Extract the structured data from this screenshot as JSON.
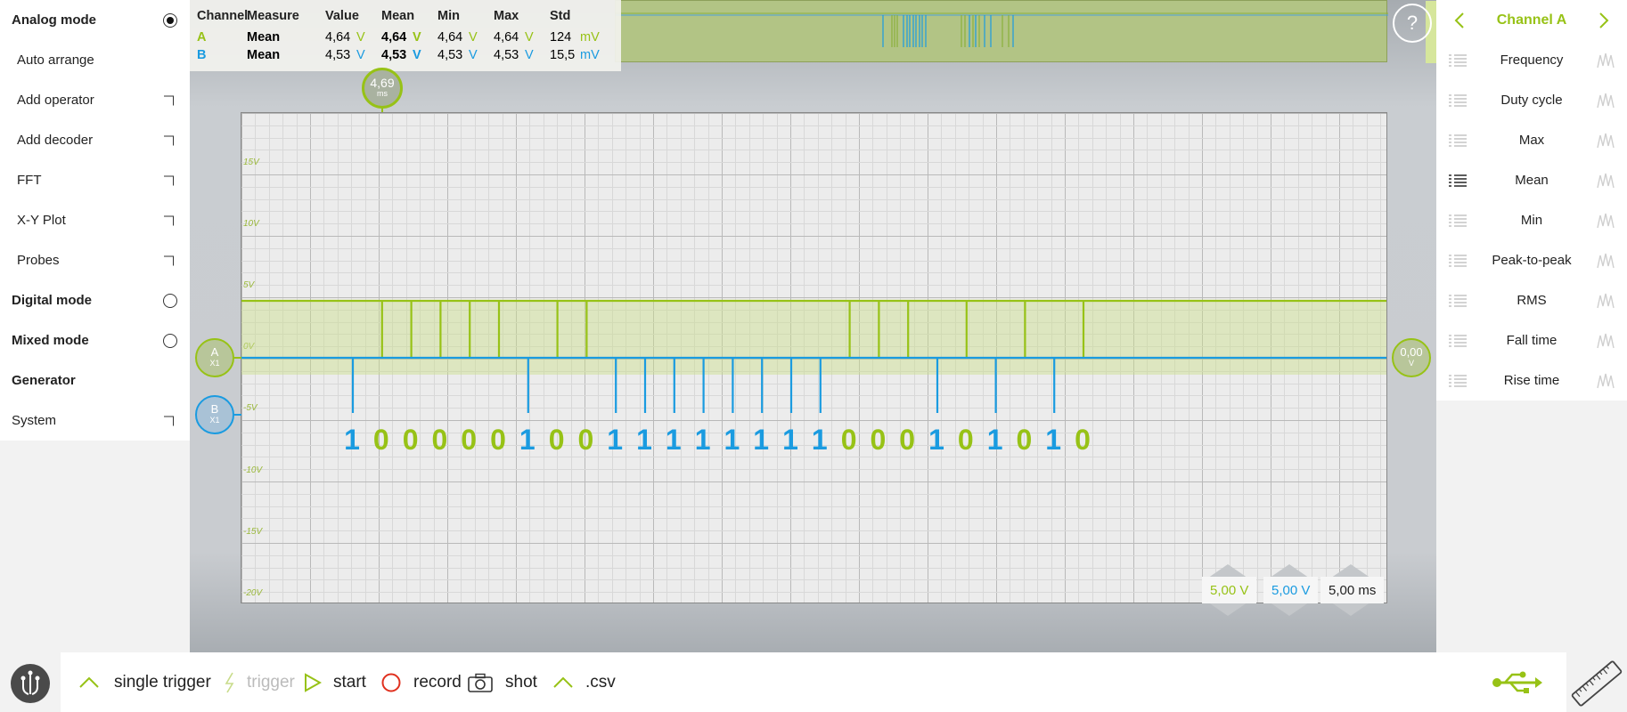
{
  "left_panel": {
    "analog_mode": "Analog mode",
    "auto_arrange": "Auto arrange",
    "add_operator": "Add operator",
    "add_decoder": "Add decoder",
    "fft": "FFT",
    "xy_plot": "X-Y Plot",
    "probes": "Probes",
    "digital_mode": "Digital mode",
    "mixed_mode": "Mixed mode",
    "generator": "Generator",
    "system": "System",
    "selected_mode": "Analog mode"
  },
  "measurements": {
    "headers": [
      "Channel",
      "Measure",
      "Value",
      "Mean",
      "Min",
      "Max",
      "Std"
    ],
    "rows": [
      {
        "channel": "A",
        "measure": "Mean",
        "value": "4,64",
        "value_unit": "V",
        "mean": "4,64",
        "mean_unit": "V",
        "min": "4,64",
        "min_unit": "V",
        "max": "4,64",
        "max_unit": "V",
        "std": "124",
        "std_unit": "mV"
      },
      {
        "channel": "B",
        "measure": "Mean",
        "value": "4,53",
        "value_unit": "V",
        "mean": "4,53",
        "mean_unit": "V",
        "min": "4,53",
        "min_unit": "V",
        "max": "4,53",
        "max_unit": "V",
        "std": "15,5",
        "std_unit": "mV"
      }
    ]
  },
  "trigger_marker": {
    "value": "4,69",
    "unit": "ms"
  },
  "y_axis_labels": [
    "15V",
    "10V",
    "5V",
    "0V",
    "-5V",
    "-10V",
    "-15V",
    "-20V"
  ],
  "channel_markers": {
    "a": {
      "label": "A",
      "sub": "X1"
    },
    "b": {
      "label": "B",
      "sub": "X1"
    },
    "offset": {
      "value": "0,00",
      "unit": "V"
    }
  },
  "decoded_bits": [
    "1",
    "0",
    "0",
    "0",
    "0",
    "0",
    "1",
    "0",
    "0",
    "1",
    "1",
    "1",
    "1",
    "1",
    "1",
    "1",
    "1",
    "0",
    "0",
    "0",
    "1",
    "0",
    "1",
    "0",
    "1",
    "0"
  ],
  "scales": {
    "channel_a": "5,00 V",
    "channel_b": "5,00 V",
    "time": "5,00 ms"
  },
  "right_panel": {
    "title": "Channel A",
    "items": [
      "Frequency",
      "Duty cycle",
      "Max",
      "Mean",
      "Min",
      "Peak-to-peak",
      "RMS",
      "Fall time",
      "Rise time"
    ],
    "active_item": "Mean"
  },
  "bottom_bar": {
    "single_trigger": "single trigger",
    "trigger": "trigger",
    "start": "start",
    "record": "record",
    "shot": "shot",
    "csv": ".csv"
  },
  "colors": {
    "channel_a": "#97c216",
    "channel_b": "#1a9be0",
    "accent": "#97c216"
  },
  "help": "?"
}
